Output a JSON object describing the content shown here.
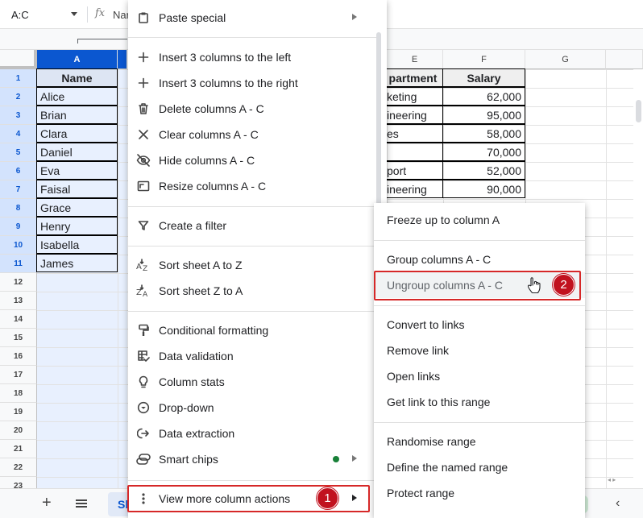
{
  "formula_bar": {
    "name_box": "A:C",
    "fx": "fx",
    "content": "Nar"
  },
  "columns": [
    {
      "id": "A",
      "selected": true
    },
    {
      "id": "E",
      "selected": false
    },
    {
      "id": "F",
      "selected": false
    },
    {
      "id": "G",
      "selected": false
    }
  ],
  "rows": [
    "1",
    "2",
    "3",
    "4",
    "5",
    "6",
    "7",
    "8",
    "9",
    "10",
    "11",
    "12",
    "13",
    "14",
    "15",
    "16",
    "17",
    "18",
    "19",
    "20",
    "21",
    "22",
    "23"
  ],
  "table": {
    "name_header": "Name",
    "department_header": "partment",
    "salary_header": "Salary",
    "names": [
      "Alice",
      "Brian",
      "Clara",
      "Daniel",
      "Eva",
      "Faisal",
      "Grace",
      "Henry",
      "Isabella",
      "James"
    ],
    "departments": [
      "keting",
      "ineering",
      "es",
      "",
      "port",
      "ineering"
    ],
    "salaries": [
      "62,000",
      "95,000",
      "58,000",
      "70,000",
      "52,000",
      "90,000"
    ]
  },
  "context_menu": {
    "items": [
      {
        "label": "Paste special",
        "icon": "clipboard-icon",
        "submenu": true
      },
      {
        "label": "Insert 3 columns to the left",
        "icon": "plus-icon"
      },
      {
        "label": "Insert 3 columns to the right",
        "icon": "plus-icon"
      },
      {
        "label": "Delete columns A - C",
        "icon": "trash-icon"
      },
      {
        "label": "Clear columns A - C",
        "icon": "x-icon"
      },
      {
        "label": "Hide columns A - C",
        "icon": "eye-off-icon"
      },
      {
        "label": "Resize columns A - C",
        "icon": "resize-icon"
      },
      {
        "label": "Create a filter",
        "icon": "filter-icon"
      },
      {
        "label": "Sort sheet A to Z",
        "icon": "sort-az-icon"
      },
      {
        "label": "Sort sheet Z to A",
        "icon": "sort-za-icon"
      },
      {
        "label": "Conditional formatting",
        "icon": "paint-roller-icon"
      },
      {
        "label": "Data validation",
        "icon": "data-validation-icon"
      },
      {
        "label": "Column stats",
        "icon": "lightbulb-icon"
      },
      {
        "label": "Drop-down",
        "icon": "dropdown-icon"
      },
      {
        "label": "Data extraction",
        "icon": "extraction-icon"
      },
      {
        "label": "Smart chips",
        "icon": "smart-chips-icon",
        "submenu": true
      },
      {
        "label": "View more column actions",
        "icon": "more-vert-icon",
        "submenu": true
      }
    ]
  },
  "submenu": {
    "items": [
      {
        "label": "Freeze up to column A"
      },
      {
        "label": "Group columns A - C"
      },
      {
        "label": "Ungroup columns A - C"
      },
      {
        "label": "Convert to links"
      },
      {
        "label": "Remove link"
      },
      {
        "label": "Open links"
      },
      {
        "label": "Get link to this range"
      },
      {
        "label": "Randomise range"
      },
      {
        "label": "Define the named range"
      },
      {
        "label": "Protect range"
      }
    ]
  },
  "annotations": {
    "step1": "1",
    "step2": "2",
    "highlight_color": "#d62828"
  },
  "tabbar": {
    "add": "+",
    "sheet_tab_partial": "Sl"
  },
  "colors": {
    "selection_header": "#0b57d0",
    "selection_fill": "#e8f0fe",
    "smart_chip_dot": "#188038"
  }
}
